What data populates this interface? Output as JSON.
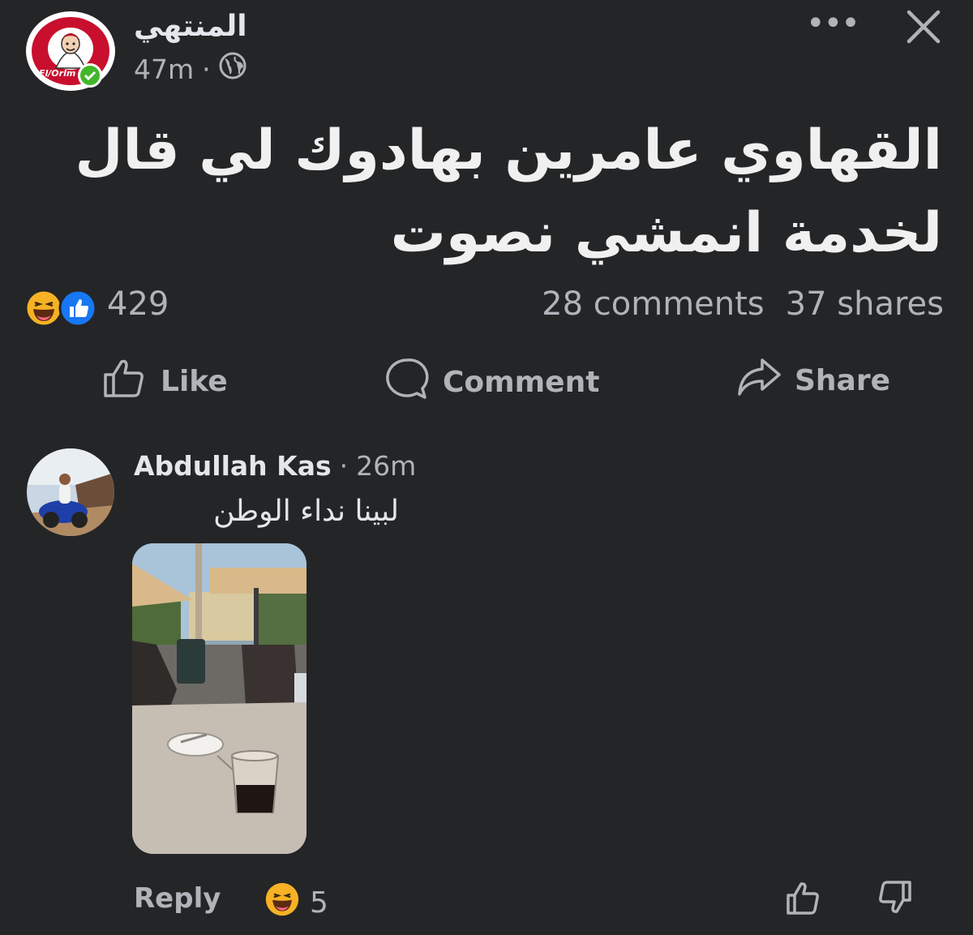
{
  "post": {
    "page_name": "المنتهي",
    "time": "47m",
    "separator": "·",
    "audience_icon": "globe-icon",
    "text_line1": "القهاوي عامرين بهادوك لي قال",
    "text_line2": "لخدمة انمشي نصوت",
    "logo_text": "El/Orlm"
  },
  "stats": {
    "reaction_count": "429",
    "comments": "28 comments",
    "shares": "37 shares",
    "reaction_icons": [
      "haha-icon",
      "like-icon"
    ]
  },
  "actions": {
    "like": "Like",
    "comment": "Comment",
    "share": "Share"
  },
  "comment": {
    "author": "Abdullah Kas",
    "separator": "·",
    "time": "26m",
    "text": "لبينا نداء الوطن",
    "reply_label": "Reply",
    "reaction_count": "5"
  },
  "colors": {
    "background": "#242526",
    "text_primary": "#e4e6eb",
    "text_secondary": "#b0b3b8",
    "like_blue": "#1877f2",
    "haha_yellow": "#f7b125",
    "verified_green": "#42b72a",
    "logo_red": "#c8102e"
  }
}
